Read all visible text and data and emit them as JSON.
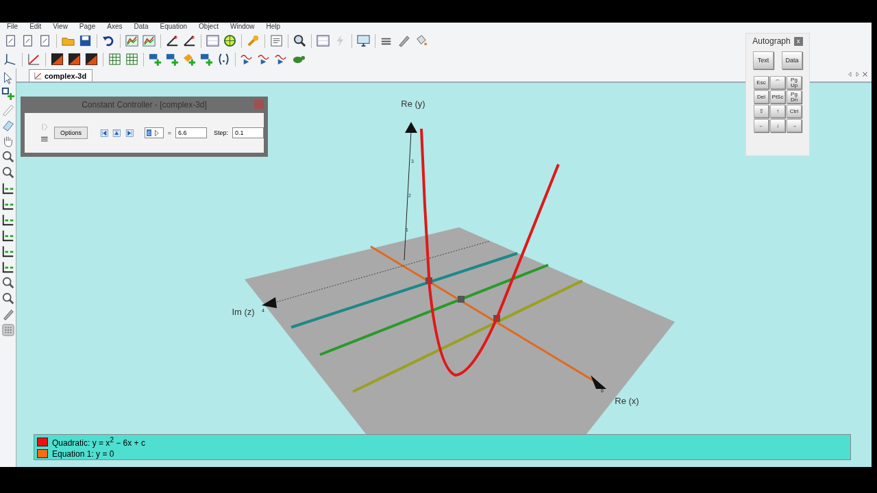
{
  "menu": [
    "File",
    "Edit",
    "View",
    "Page",
    "Axes",
    "Data",
    "Equation",
    "Object",
    "Window",
    "Help"
  ],
  "tab": {
    "label": "complex-3d",
    "selected": true
  },
  "controller": {
    "title": "Constant Controller - [complex-3d]",
    "options_button": "Options",
    "constant": "c",
    "equals": "=",
    "value": "6.6",
    "step_label": "Step:",
    "step": "0.1"
  },
  "palette": {
    "title": "Autograph",
    "close": "x",
    "big_keys": [
      "Text",
      "Data"
    ],
    "keys": [
      "Esc",
      "⌒",
      "Pg Up",
      "Del",
      "PtSc",
      "Pg Dn",
      "⇧",
      "↑",
      "Ctrl",
      "←",
      "↓",
      "→"
    ]
  },
  "scene": {
    "axis_labels": [
      "Re (y)",
      "Im (z)",
      "Re (x)"
    ],
    "y_ticks": [
      "1",
      "2",
      "3"
    ],
    "z_tick": "4",
    "x_tick": "6"
  },
  "legend": {
    "items": [
      {
        "label": "Quadratic: y = x$^{2}$ − 6x + c",
        "color": "#ee1111"
      },
      {
        "label": "Equation 1: y = 0",
        "color": "#ff6a10"
      }
    ]
  }
}
